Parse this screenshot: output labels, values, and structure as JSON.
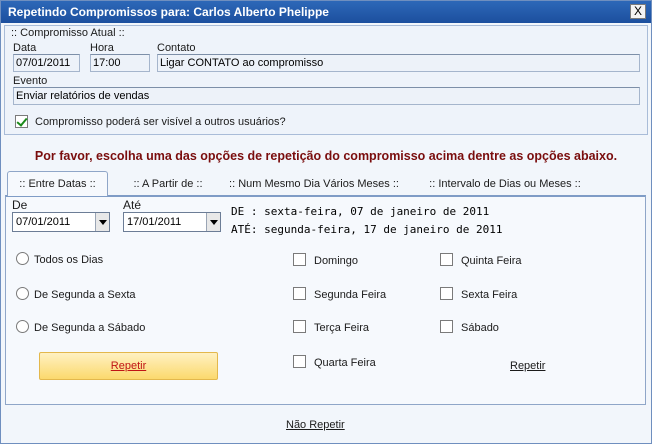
{
  "window": {
    "title": "Repetindo Compromissos para: Carlos Alberto Phelippe",
    "close_label": "X"
  },
  "current": {
    "group_title": ":: Compromisso Atual ::",
    "data_label": "Data",
    "data_value": "07/01/2011",
    "hora_label": "Hora",
    "hora_value": "17:00",
    "contato_label": "Contato",
    "contato_value": "Ligar CONTATO ao compromisso",
    "evento_label": "Evento",
    "evento_value": "Enviar relatórios de vendas",
    "visible_label": "Compromisso poderá ser visível a outros usuários?",
    "visible_checked": true
  },
  "instruction": "Por favor, escolha uma das opções de repetição do compromisso acima dentre as opções abaixo.",
  "tabs": [
    {
      "label": ":: Entre Datas ::",
      "active": true
    },
    {
      "label": ":: A Partir de ::",
      "active": false
    },
    {
      "label": ":: Num Mesmo Dia Vários Meses ::",
      "active": false
    },
    {
      "label": ":: Intervalo de Dias ou Meses ::",
      "active": false
    }
  ],
  "range": {
    "de_label": "De",
    "de_value": "07/01/2011",
    "ate_label": "Até",
    "ate_value": "17/01/2011",
    "summary_de": "DE : sexta-feira, 07 de janeiro de 2011",
    "summary_ate": "ATÉ: segunda-feira, 17 de janeiro de 2011"
  },
  "radio_options": [
    "Todos os Dias",
    "De Segunda a Sexta",
    "De Segunda a Sábado"
  ],
  "weekdays_col1": [
    "Domingo",
    "Segunda Feira",
    "Terça Feira",
    "Quarta Feira"
  ],
  "weekdays_col2": [
    "Quinta Feira",
    "Sexta Feira",
    "Sábado"
  ],
  "repeat_button_label": "Repetir",
  "repeat_link_label": "Repetir",
  "no_repeat_label": "Não Repetir",
  "colors": {
    "title_bar": "#1f56a6",
    "instruction": "#7a0d0d",
    "repeat_button": "#fbd96d",
    "checkmark": "#1a8a1a"
  }
}
